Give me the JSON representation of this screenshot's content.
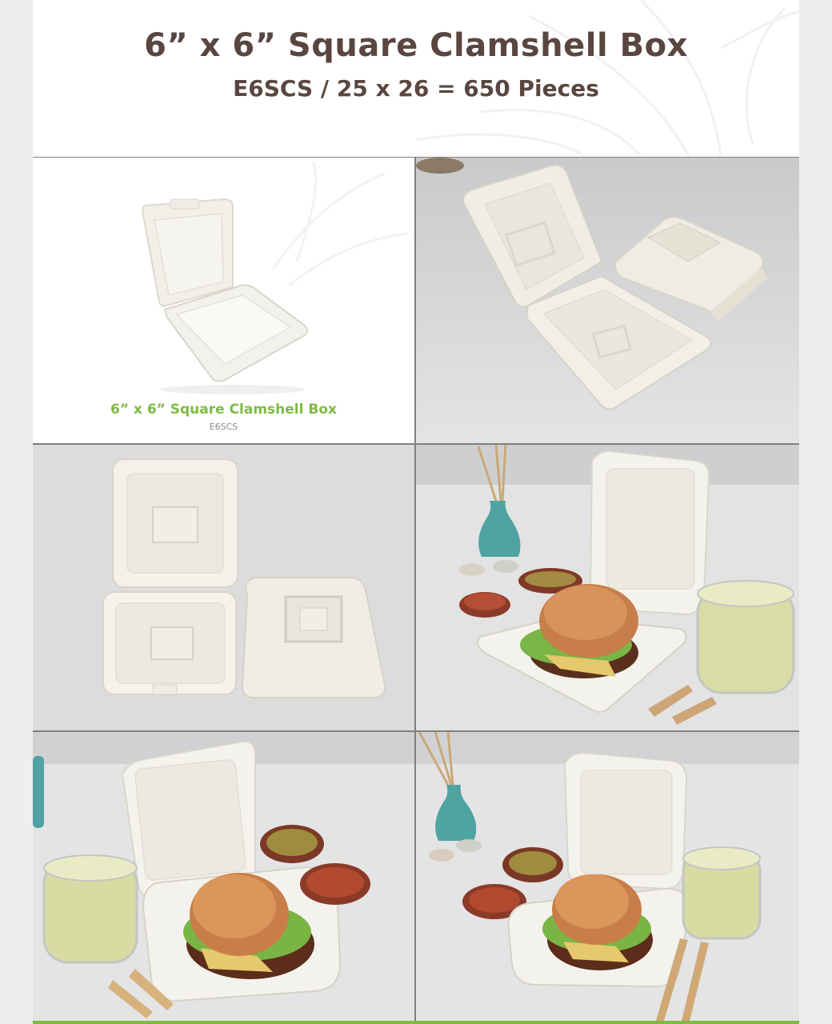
{
  "header": {
    "title": "6” x 6” Square Clamshell Box",
    "subtitle": "E6SCS / 25 x 26 = 650 Pieces"
  },
  "gallery": {
    "product_card": {
      "caption": "6” x 6” Square Clamshell Box",
      "code": "E6SCS"
    }
  },
  "colors": {
    "title_text": "#5a4640",
    "caption_green": "#7dbb42",
    "accent_bar": "#7dbb42",
    "divider_gray": "#7f7f7f"
  }
}
